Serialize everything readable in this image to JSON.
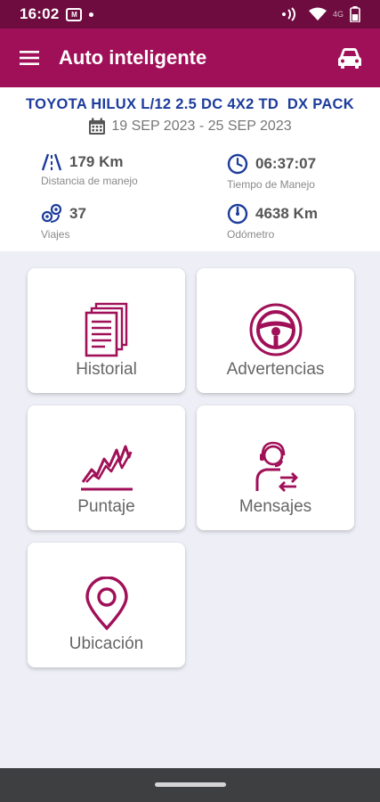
{
  "status_bar": {
    "time": "16:02",
    "notification_badge": "M",
    "network_label": "4G"
  },
  "app_bar": {
    "title": "Auto inteligente",
    "menu_icon": "hamburger-menu-icon",
    "action_icon": "car-icon"
  },
  "vehicle": {
    "name": "TOYOTA HILUX L/12 2.5 DC 4X2 TD  DX PACK",
    "date_range": "19 SEP 2023 - 25 SEP 2023"
  },
  "stats": {
    "distance": {
      "value": "179 Km",
      "label": "Distancia de manejo"
    },
    "drive_time": {
      "value": "06:37:07",
      "label": "Tiempo de Manejo"
    },
    "trips": {
      "value": "37",
      "label": "Viajes"
    },
    "odometer": {
      "value": "4638 Km",
      "label": "Odómetro"
    }
  },
  "menu": {
    "historial": "Historial",
    "advertencias": "Advertencias",
    "puntaje": "Puntaje",
    "mensajes": "Mensajes",
    "ubicacion": "Ubicación"
  },
  "colors": {
    "primary": "#a01058",
    "status_bar": "#6e0c3f",
    "vehicle_text": "#1d3c9c",
    "stat_icon": "#1d3c9c",
    "background": "#eeeef6",
    "nav_bar": "#3e3f41"
  }
}
